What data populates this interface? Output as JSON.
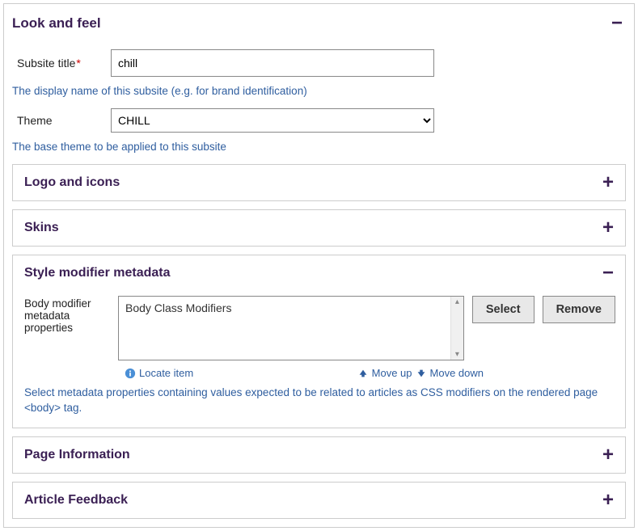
{
  "main": {
    "title": "Look and feel",
    "collapsed": false,
    "toggle_glyph": "−"
  },
  "fields": {
    "subsite_title": {
      "label": "Subsite title",
      "required_mark": "*",
      "value": "chill",
      "helper": "The display name of this subsite (e.g. for brand identification)"
    },
    "theme": {
      "label": "Theme",
      "value": "CHILL",
      "helper": "The base theme to be applied to this subsite"
    }
  },
  "panels": {
    "logo": {
      "title": "Logo and icons",
      "toggle_glyph": "+"
    },
    "skins": {
      "title": "Skins",
      "toggle_glyph": "+"
    },
    "style_mod": {
      "title": "Style modifier metadata",
      "toggle_glyph": "−",
      "label": "Body modifier metadata properties",
      "item": "Body Class Modifiers",
      "select_btn": "Select",
      "remove_btn": "Remove",
      "locate": "Locate item",
      "move_up": "Move up",
      "move_down": "Move down",
      "helper": "Select metadata properties containing values expected to be related to articles as CSS modifiers on the rendered page <body> tag."
    },
    "page_info": {
      "title": "Page Information",
      "toggle_glyph": "+"
    },
    "feedback": {
      "title": "Article Feedback",
      "toggle_glyph": "+"
    }
  }
}
